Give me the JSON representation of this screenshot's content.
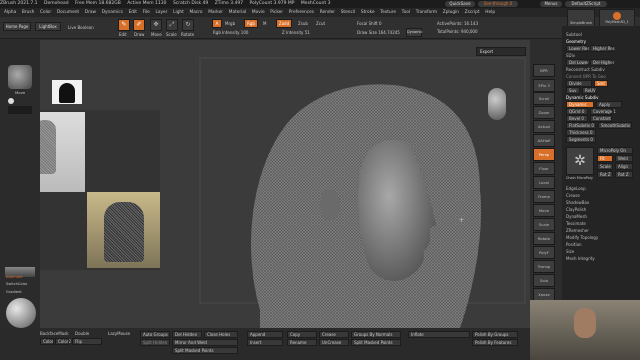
{
  "titlebar": {
    "items": [
      "ZBrush 2021.7.1",
      "Demohead",
      "Free Mem 18.682GB",
      "Active Mem 1130",
      "Scratch Disk 49",
      "ZTime 3.497",
      "PolyCount 3.979 MP",
      "MeshCount 3"
    ]
  },
  "quick": {
    "quicksave": "QuickSave",
    "seethrough": "See-through 0",
    "menus": "Menus",
    "defaultscript": "DefaultZScript"
  },
  "menubar": {
    "items": [
      "Alpha",
      "Brush",
      "Color",
      "Document",
      "Draw",
      "Dynamics",
      "Edit",
      "File",
      "Layer",
      "Light",
      "Macro",
      "Marker",
      "Material",
      "Movie",
      "Picker",
      "Preferences",
      "Render",
      "Stencil",
      "Stroke",
      "Texture",
      "Tool",
      "Transform",
      "Zplugin",
      "Zscript",
      "Help"
    ]
  },
  "toolbar": {
    "home": "Home Page",
    "lightbox": "LightBox",
    "liveboolean": "Live Boolean",
    "edit": "Edit",
    "draw": "Draw",
    "move": "Move",
    "scale": "Scale",
    "rotate": "Rotate",
    "a_label": "A",
    "mrgb": "Mrgb",
    "rgb": "Rgb",
    "m": "M",
    "zadd": "Zadd",
    "zsub": "Zsub",
    "zcut": "Zcut",
    "rgb_intensity": "Rgb Intensity 100",
    "z_intensity": "Z Intensity 51",
    "focal_shift": "Focal Shift 0",
    "draw_size": "Draw Size 164.74245",
    "dynamic": "Dynamic",
    "active_points": "ActivePoints: 16.143",
    "total_points": "TotalPoints: 940,000"
  },
  "right_top": {
    "simplebrush": "SimpleBrush",
    "polymesh": "PolyMesh3D_1"
  },
  "leftpanel": {
    "brush_label": "Move",
    "alternate": "Alternate",
    "switchcolor": "SwitchColor",
    "gradient": "Gradient"
  },
  "viewport": {
    "export": "Export"
  },
  "shelf": [
    "BPR",
    "SPix 3",
    "Scroll",
    "Zoom",
    "Actual",
    "AAHalf",
    "Persp",
    "Floor",
    "Local",
    "Frame",
    "Move",
    "Scale",
    "Rotate",
    "PolyF",
    "Transp",
    "Solo",
    "Xpose"
  ],
  "subtool": {
    "header": "Subtool",
    "geometry": "Geometry",
    "lower_res": "Lower Res",
    "higher_res": "Higher Res",
    "sdiv": "SDiv",
    "del_lower": "Del Lower",
    "del_higher": "Del Higher",
    "reconstruct": "Reconstruct Subdiv",
    "convert_bpr": "Convert BPR To Geo",
    "divide": "Divide",
    "smt": "Smt",
    "suv": "Suv",
    "reuv": "ReUV",
    "dynamic_subdiv": "Dynamic Subdiv",
    "dynamic": "Dynamic",
    "apply": "Apply",
    "qgrid": "QGrid 0",
    "coverage": "Coverage 1",
    "bevel": "Bevel 0",
    "constant": "Constant",
    "flatsubdiv": "FlatSubdiv 0",
    "smoothsubdiv": "SmoothSubdiv",
    "thickness": "Thickness 0",
    "segments": "Segments 0",
    "micropoly_label": "MicroPoly On",
    "fit": "Fit",
    "weld": "Weld",
    "scale": "Scale",
    "align": "Align",
    "rotz": "Rot Z",
    "rotz2": "Rot Z",
    "micropoly_name": "Chain MicroPoly",
    "list": [
      "EdgeLoop",
      "Crease",
      "ShadowBox",
      "ClayPolish",
      "DynaMesh",
      "Tessimate",
      "ZRemesher",
      "Modify Topology",
      "Position",
      "Size",
      "Mesh Integrity"
    ]
  },
  "bottombar": {
    "backfacemask": "BackfaceMask",
    "double": "Double",
    "lazymouse": "LazyMouse",
    "color1": "Color",
    "color2": "Color2",
    "flip": "Flip",
    "autogroups": "Auto Groups",
    "delhidden": "Del Hidden",
    "closeholes": "Close Holes",
    "splithidden": "Split Hidden",
    "mirrorweld": "Mirror And Weld",
    "splitmasked": "Split Masked Points",
    "append": "Append",
    "insert": "Insert",
    "copy": "Copy",
    "rename": "Rename",
    "crease": "Crease",
    "uncrease": "UnCrease",
    "groupsbynormals": "Groups By Normals",
    "splitmasked2": "Split Masked Points",
    "inflate": "Inflate",
    "polishbygroups": "Polish By Groups",
    "polishbyfeatures": "Polish By Features"
  },
  "colors": {
    "accent": "#d9702a",
    "panel": "#2b2b2b",
    "viewport": "#3b3b3b"
  }
}
